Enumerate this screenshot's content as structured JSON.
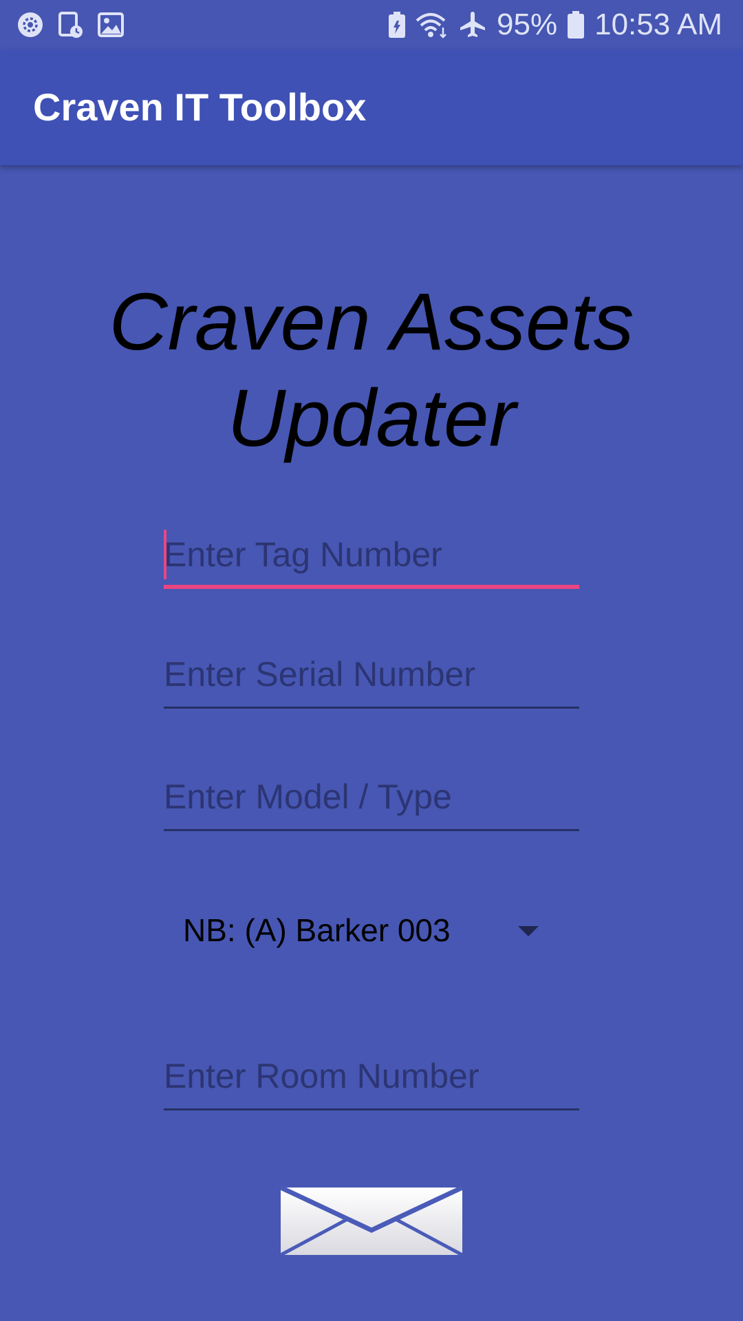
{
  "status_bar": {
    "battery_percent": "95%",
    "time": "10:53 AM",
    "icons": [
      "settings-icon",
      "screen-timer-icon",
      "gallery-icon",
      "battery-saver-icon",
      "wifi-icon",
      "airplane-mode-icon",
      "battery-icon"
    ]
  },
  "app_bar": {
    "title": "Craven IT Toolbox"
  },
  "main": {
    "heading_line1": "Craven Assets",
    "heading_line2": "Updater",
    "tag_field": {
      "value": "",
      "placeholder": "Enter Tag Number"
    },
    "serial_field": {
      "value": "",
      "placeholder": "Enter Serial Number"
    },
    "model_field": {
      "value": "",
      "placeholder": "Enter Model / Type"
    },
    "location_spinner": {
      "selected": "NB: (A) Barker 003"
    },
    "room_field": {
      "value": "",
      "placeholder": "Enter Room Number"
    },
    "send_button": {
      "icon": "envelope-icon"
    }
  },
  "colors": {
    "background": "#4757b3",
    "app_bar": "#3f51b5",
    "accent": "#ea4683",
    "hint_text": "#2c3573"
  }
}
